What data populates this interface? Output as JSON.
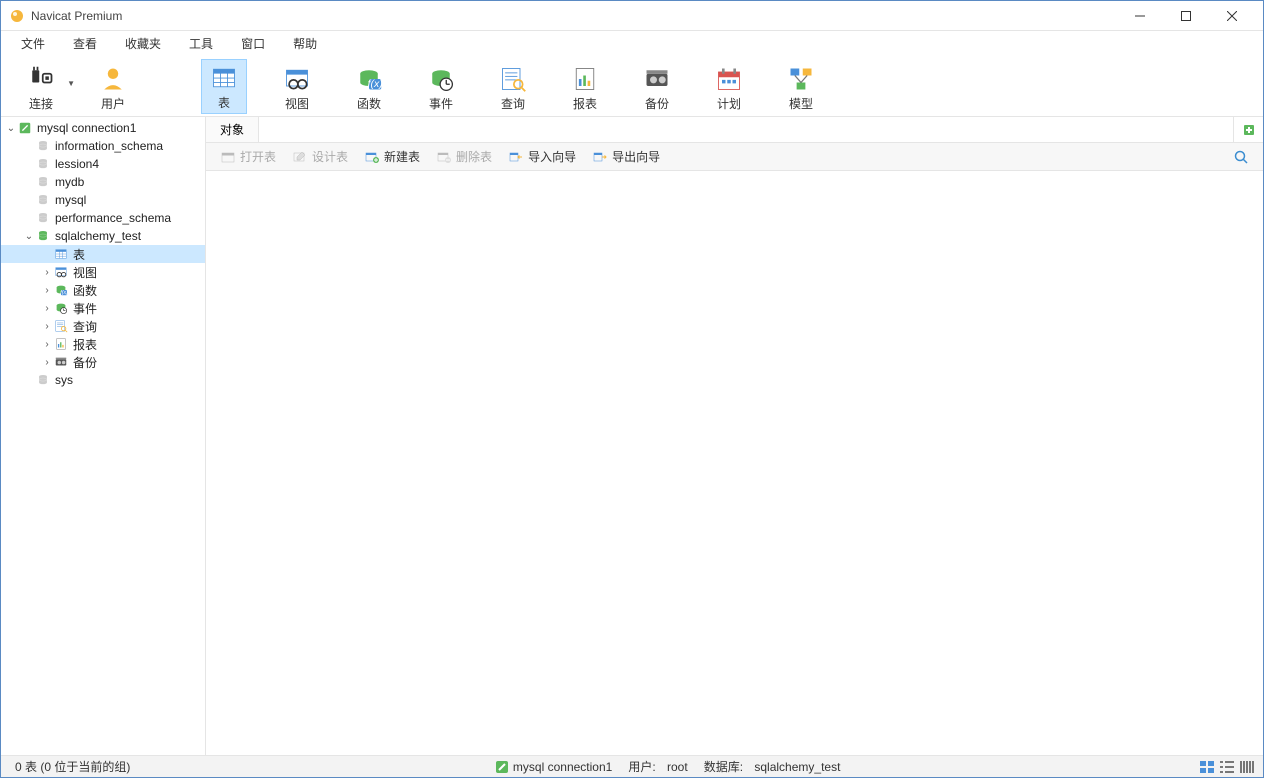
{
  "app": {
    "title": "Navicat Premium"
  },
  "menu": {
    "items": [
      "文件",
      "查看",
      "收藏夹",
      "工具",
      "窗口",
      "帮助"
    ]
  },
  "toolbar": {
    "items": [
      {
        "label": "连接",
        "icon": "plug",
        "dropdown": true
      },
      {
        "label": "用户",
        "icon": "user"
      },
      {
        "label": "表",
        "icon": "table",
        "active": true
      },
      {
        "label": "视图",
        "icon": "view"
      },
      {
        "label": "函数",
        "icon": "fx"
      },
      {
        "label": "事件",
        "icon": "event"
      },
      {
        "label": "查询",
        "icon": "query"
      },
      {
        "label": "报表",
        "icon": "report"
      },
      {
        "label": "备份",
        "icon": "backup"
      },
      {
        "label": "计划",
        "icon": "schedule"
      },
      {
        "label": "模型",
        "icon": "model"
      }
    ]
  },
  "tree": {
    "connection": "mysql connection1",
    "databases": [
      {
        "label": "information_schema"
      },
      {
        "label": "lession4"
      },
      {
        "label": "mydb"
      },
      {
        "label": "mysql"
      },
      {
        "label": "performance_schema"
      },
      {
        "label": "sqlalchemy_test",
        "open": true,
        "children": [
          {
            "label": "表",
            "icon": "table",
            "selected": true
          },
          {
            "label": "视图",
            "icon": "view",
            "expandable": true
          },
          {
            "label": "函数",
            "icon": "fx",
            "expandable": true
          },
          {
            "label": "事件",
            "icon": "event",
            "expandable": true
          },
          {
            "label": "查询",
            "icon": "query",
            "expandable": true
          },
          {
            "label": "报表",
            "icon": "report",
            "expandable": true
          },
          {
            "label": "备份",
            "icon": "backup",
            "expandable": true
          }
        ]
      },
      {
        "label": "sys"
      }
    ]
  },
  "tabs": {
    "items": [
      "对象"
    ]
  },
  "subtoolbar": {
    "items": [
      {
        "label": "打开表",
        "icon": "open",
        "disabled": true
      },
      {
        "label": "设计表",
        "icon": "design",
        "disabled": true
      },
      {
        "label": "新建表",
        "icon": "new"
      },
      {
        "label": "删除表",
        "icon": "delete",
        "disabled": true
      },
      {
        "label": "导入向导",
        "icon": "import"
      },
      {
        "label": "导出向导",
        "icon": "export"
      }
    ]
  },
  "status": {
    "left": "0 表 (0 位于当前的组)",
    "connection": "mysql connection1",
    "user_label": "用户:",
    "user": "root",
    "db_label": "数据库:",
    "db": "sqlalchemy_test"
  }
}
